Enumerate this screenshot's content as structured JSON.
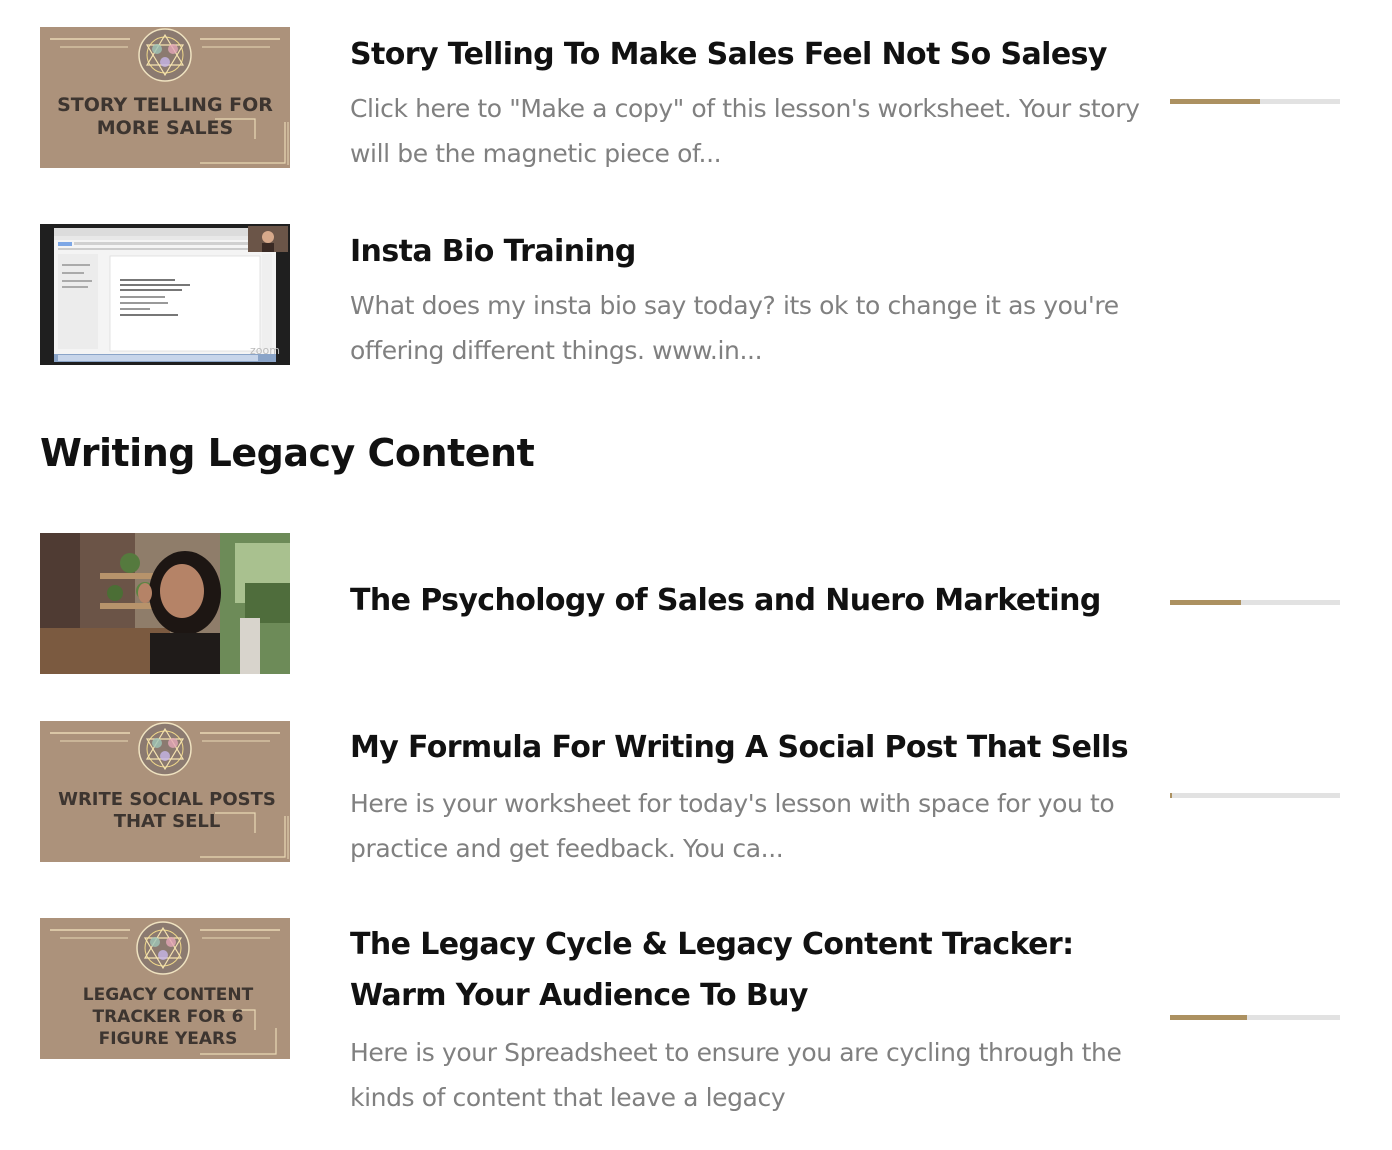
{
  "lessons_top": [
    {
      "title": "Story Telling To Make Sales Feel Not So Salesy",
      "description": "Click here to \"Make a copy\" of this lesson's worksheet.  Your story will be the magnetic piece of...",
      "thumbnail_text": [
        "STORY TELLING FOR",
        "MORE SALES"
      ],
      "progress": 0.53
    },
    {
      "title": "Insta Bio Training",
      "description": "What does my insta bio say today? its ok to change it as you're offering different things. www.in...",
      "thumbnail_text": [],
      "progress": null
    }
  ],
  "section": {
    "title": "Writing Legacy Content"
  },
  "lessons_section": [
    {
      "title": "The Psychology of Sales and Nuero Marketing",
      "description": "",
      "thumbnail_text": [],
      "progress": 0.42
    },
    {
      "title": "My Formula For Writing A Social Post That Sells",
      "description": "Here is your worksheet for today's lesson with space for you to practice and get feedback. You ca...",
      "thumbnail_text": [
        "WRITE SOCIAL POSTS",
        "THAT SELL"
      ],
      "progress": 0.01
    },
    {
      "title": "The Legacy Cycle & Legacy Content Tracker: Warm Your Audience To Buy",
      "description": "Here is your Spreadsheet to ensure you are cycling through the kinds of content that leave a legacy",
      "thumbnail_text": [
        "LEGACY CONTENT",
        "TRACKER FOR 6",
        "FIGURE YEARS"
      ],
      "progress": 0.45
    }
  ],
  "colors": {
    "progress_fill": "#ac9161",
    "progress_track": "#e2e2e2",
    "title": "#111111",
    "description": "#808080",
    "thumbnail_bg": "#a68e78"
  },
  "icons": {
    "mandala": "mandala-icon"
  }
}
